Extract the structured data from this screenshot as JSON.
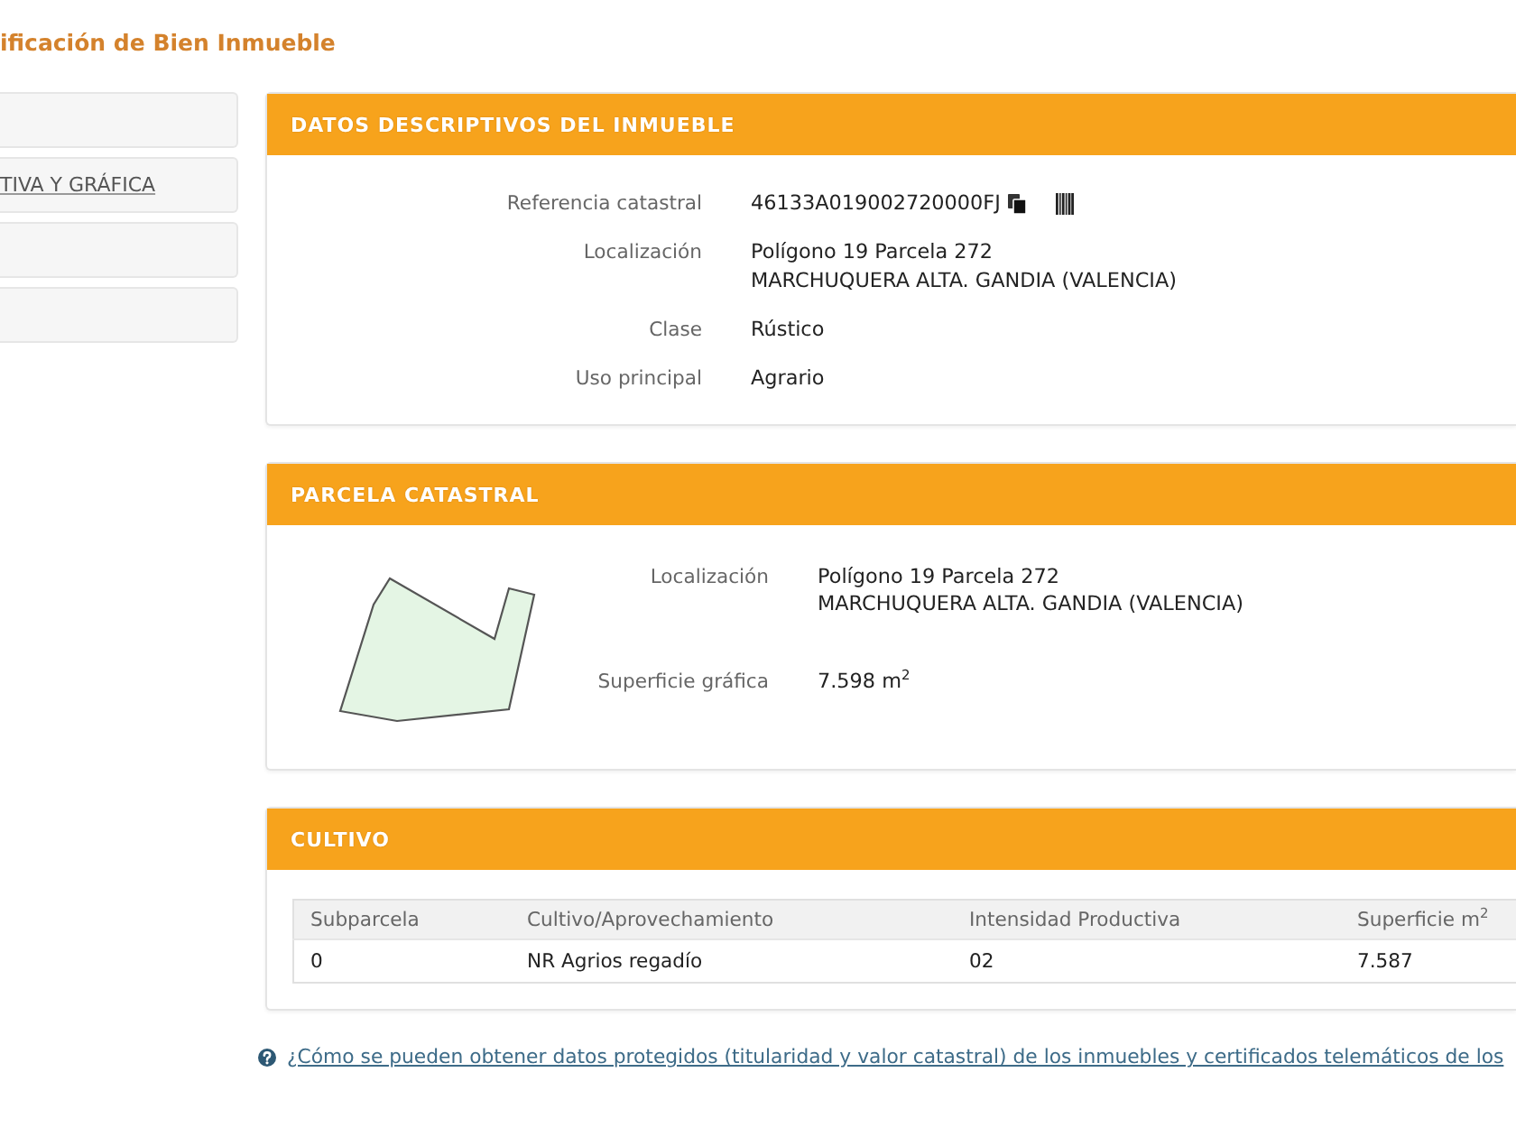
{
  "page_title": "ificación de Bien Inmueble",
  "sidebar": {
    "items": [
      {
        "kind": "blank"
      },
      {
        "kind": "link",
        "label": "TIVA Y GRÁFICA"
      },
      {
        "kind": "blank"
      },
      {
        "kind": "blank"
      }
    ]
  },
  "sections": [
    {
      "kind": "details",
      "title": "DATOS DESCRIPTIVOS DEL INMUEBLE",
      "fields": [
        {
          "kind": "reference",
          "label": "Referencia catastral",
          "lines": [
            "46133A019002720000FJ"
          ]
        },
        {
          "kind": "text",
          "label": "Localización",
          "lines": [
            "Polígono 19 Parcela 272",
            "MARCHUQUERA ALTA. GANDIA (VALENCIA)"
          ]
        },
        {
          "kind": "text",
          "label": "Clase",
          "lines": [
            "Rústico"
          ]
        },
        {
          "kind": "text",
          "label": "Uso principal",
          "lines": [
            "Agrario"
          ]
        }
      ]
    },
    {
      "kind": "parcel",
      "title": "PARCELA CATASTRAL",
      "fields": [
        {
          "kind": "text",
          "label": "Localización",
          "lines": [
            "Polígono 19 Parcela 272",
            "MARCHUQUERA ALTA. GANDIA (VALENCIA)"
          ]
        },
        {
          "kind": "text",
          "label": "Superficie gráfica",
          "lines": [
            "7.598 m$^{2}$"
          ]
        }
      ]
    },
    {
      "kind": "table",
      "title": "CULTIVO",
      "columns": [
        "Subparcela",
        "Cultivo/Aprovechamiento",
        "Intensidad Productiva",
        "Superficie m$^{2}$"
      ],
      "rows": [
        [
          "0",
          "NR Agrios regadío",
          "02",
          "7.587"
        ]
      ]
    }
  ],
  "help_link": {
    "text": "¿Cómo se pueden obtener datos protegidos (titularidad y valor catastral) de los inmuebles y certificados telemáticos de los"
  }
}
